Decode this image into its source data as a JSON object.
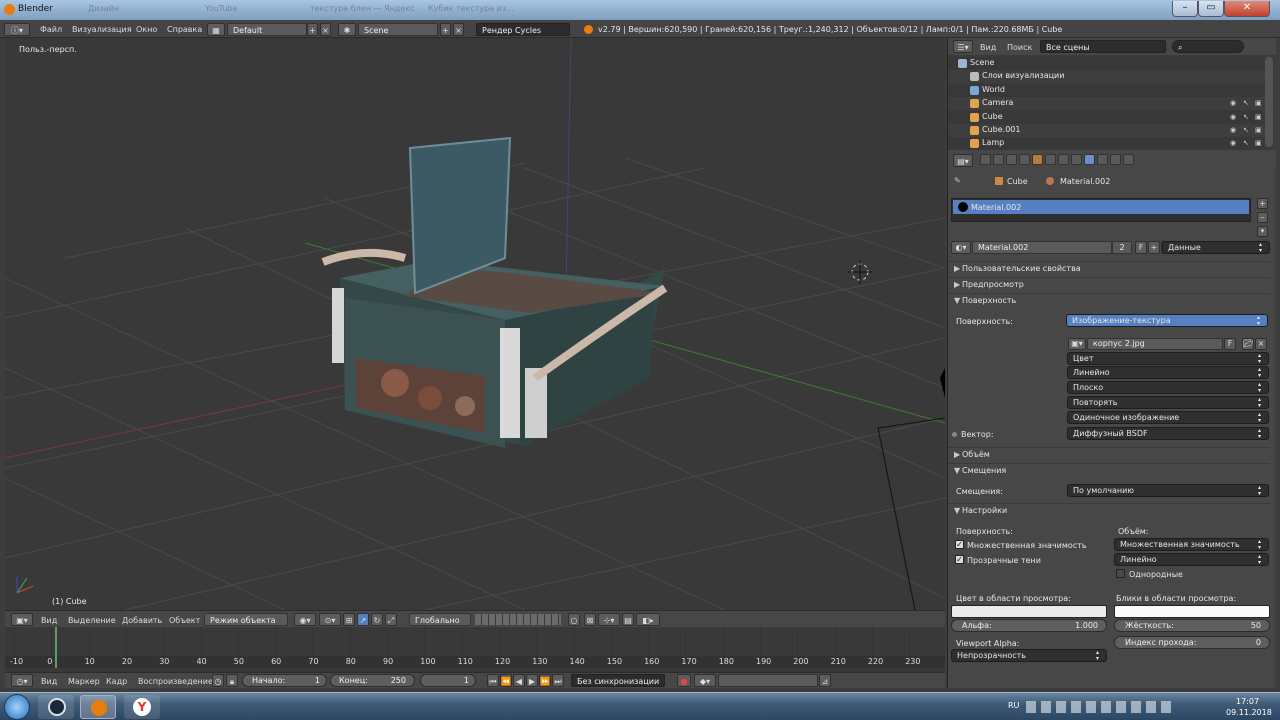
{
  "window": {
    "title": "Blender",
    "ghost_tabs": [
      "Дизайн",
      "YouTube",
      "Blender",
      "YouTube",
      "текстура блен — Яндекс",
      "Кубик текстура из..."
    ]
  },
  "header": {
    "menus": [
      "Файл",
      "Визуализация",
      "Окно",
      "Справка"
    ],
    "layout": "Default",
    "scene": "Scene",
    "engine": "Рендер Cycles",
    "stats": "v2.79 | Вершин:620,590 | Граней:620,156 | Треуг.:1,240,312 | Объектов:0/12 | Ламп:0/1 | Пам.:220.68МБ | Cube"
  },
  "viewport": {
    "view_label": "Польз.-персп.",
    "object_label": "(1) Cube",
    "header_menus": [
      "Вид",
      "Выделение",
      "Добавить",
      "Объект"
    ],
    "mode": "Режим объекта",
    "orientation": "Глобально"
  },
  "timeline": {
    "ticks": [
      "-10",
      "0",
      "10",
      "20",
      "30",
      "40",
      "50",
      "60",
      "70",
      "80",
      "90",
      "100",
      "110",
      "120",
      "130",
      "140",
      "150",
      "160",
      "170",
      "180",
      "190",
      "200",
      "210",
      "220",
      "230"
    ],
    "current_frame_value": 1,
    "menus": [
      "Вид",
      "Маркер",
      "Кадр",
      "Воспроизведение"
    ],
    "start_label": "Начало:",
    "start_value": "1",
    "end_label": "Конец:",
    "end_value": "250",
    "current_value": "1",
    "sync": "Без синхронизации"
  },
  "outliner": {
    "view_menu": "Вид",
    "search_menu": "Поиск",
    "filter": "Все сцены",
    "items": [
      {
        "name": "Scene",
        "color": "#9bb3d4"
      },
      {
        "name": "Слои визуализации",
        "color": "#bbbbbb"
      },
      {
        "name": "World",
        "color": "#7aa7d8"
      },
      {
        "name": "Camera",
        "color": "#e2a34e"
      },
      {
        "name": "Cube",
        "color": "#e2a34e"
      },
      {
        "name": "Cube.001",
        "color": "#e2a34e"
      },
      {
        "name": "Lamp",
        "color": "#e2a34e"
      }
    ]
  },
  "properties": {
    "breadcrumb_object": "Cube",
    "breadcrumb_material": "Material.002",
    "slot_material": "Material.002",
    "material_name": "Material.002",
    "users": "2",
    "fake_user": "F",
    "link": "Данные",
    "panels": {
      "custom_props": "Пользовательские свойства",
      "preview": "Предпросмотр",
      "surface": "Поверхность",
      "volume": "Объём",
      "displacement": "Смещения",
      "settings": "Настройки"
    },
    "surface": {
      "surface_label": "Поверхность:",
      "surface_value": "Изображение-текстура",
      "image_name": "корпус 2.jpg",
      "image_f": "F",
      "color": "Цвет",
      "interp": "Линейно",
      "projection": "Плоско",
      "extension": "Повторять",
      "source": "Одиночное изображение",
      "vector_label": "Вектор:",
      "vector_value": "Диффузный BSDF"
    },
    "displacement": {
      "label": "Смещения:",
      "value": "По умолчанию"
    },
    "settings": {
      "surface_col": "Поверхность:",
      "volume_col": "Объём:",
      "multiple_importance": "Множественная значимость",
      "transparent_shadows": "Прозрачные тени",
      "vol_sampling": "Множественная значимость",
      "vol_interp": "Линейно",
      "homogeneous": "Однородные",
      "viewport_color_label": "Цвет в области просмотра:",
      "specular_label": "Блики в области просмотра:",
      "alpha_label": "Альфа:",
      "alpha_value": "1.000",
      "hardness_label": "Жёсткость:",
      "hardness_value": "50",
      "pass_index_label": "Индекс прохода:",
      "pass_index_value": "0",
      "viewport_alpha_label": "Viewport Alpha:",
      "viewport_alpha_value": "Непрозрачность"
    }
  },
  "taskbar": {
    "lang": "RU",
    "time": "17:07",
    "date": "09.11.2018"
  }
}
